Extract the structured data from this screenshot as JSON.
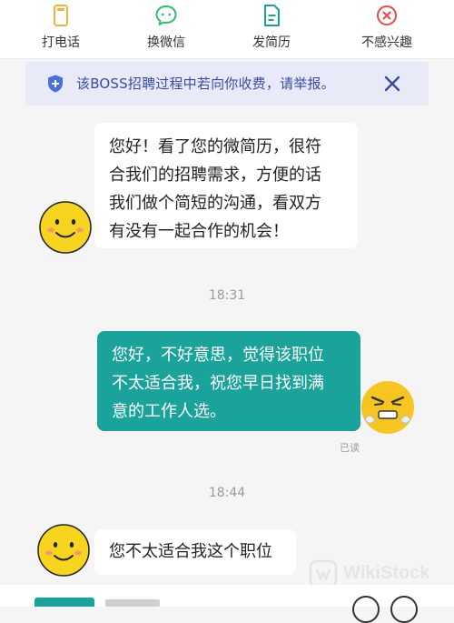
{
  "actions": [
    {
      "label": "打电话",
      "icon": "phone-icon",
      "color": "#f2b233"
    },
    {
      "label": "换微信",
      "icon": "wechat-icon",
      "color": "#2fc06b"
    },
    {
      "label": "发简历",
      "icon": "resume-icon",
      "color": "#1aa39a"
    },
    {
      "label": "不感兴趣",
      "icon": "not-interested-icon",
      "color": "#e94a4a"
    }
  ],
  "notice": {
    "text": "该BOSS招聘过程中若向你收费，请举报。",
    "icon": "shield-icon",
    "close_icon": "close-icon"
  },
  "messages": [
    {
      "from": "recruiter",
      "lines": [
        "您好！看了您的微简历，很符",
        "合我们的招聘需求，方便的话",
        "我们做个简短的沟通，看双方",
        "有没有一起合作的机会！"
      ]
    },
    {
      "type": "time",
      "text": "18:31"
    },
    {
      "from": "me",
      "lines": [
        "您好，不好意思，觉得该职位",
        "不太适合我，祝您早日找到满",
        "意的工作人选。"
      ],
      "status": "已读"
    },
    {
      "type": "time",
      "text": "18:44"
    },
    {
      "from": "recruiter",
      "lines": [
        "您不太适合我这个职位"
      ]
    }
  ],
  "watermark": "WikiStock",
  "colors": {
    "accent": "#1aa39a",
    "notice_text": "#3a4aa8",
    "notice_bg": "#e8ebf7"
  }
}
